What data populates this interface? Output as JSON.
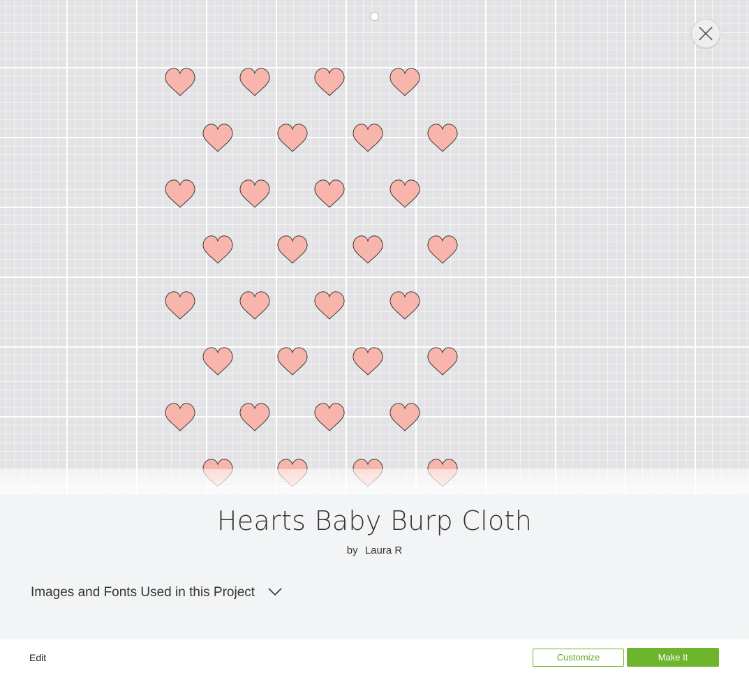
{
  "project": {
    "title": "Hearts Baby Burp Cloth",
    "by_label": "by",
    "author": "Laura R"
  },
  "images_fonts": {
    "label": "Images and Fonts Used in this Project",
    "icon": "chevron-down-icon"
  },
  "preview": {
    "close_icon": "close-icon",
    "heart_color": "#f7b5ac",
    "grid_color": "#e3e3e5"
  },
  "footer": {
    "edit_label": "Edit",
    "customize_label": "Customize",
    "make_it_label": "Make It",
    "accent_color": "#6cb52d"
  }
}
